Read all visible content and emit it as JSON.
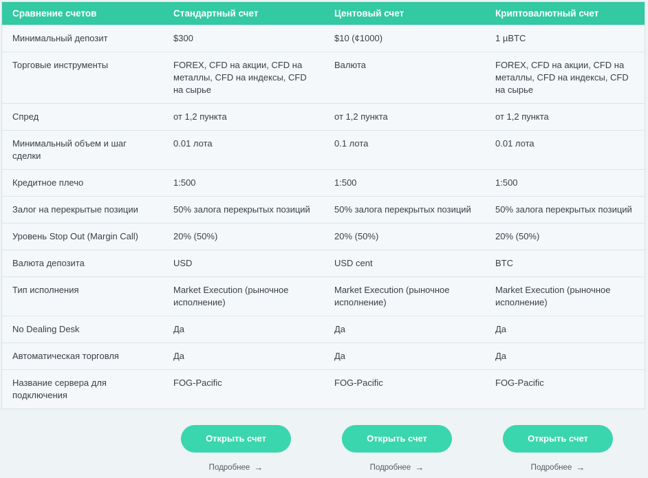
{
  "table": {
    "headers": [
      "Сравнение счетов",
      "Стандартный счет",
      "Центовый счет",
      "Криптовалютный счет"
    ],
    "rows": [
      {
        "label": "Минимальный депозит",
        "values": [
          "$300",
          "$10 (¢1000)",
          "1 µBTC"
        ]
      },
      {
        "label": "Торговые инструменты",
        "values": [
          "FOREX, CFD на акции, CFD на металлы, CFD на индексы, CFD на сырье",
          "Валюта",
          "FOREX, CFD на акции, CFD на металлы, CFD на индексы, CFD на сырье"
        ]
      },
      {
        "label": "Спред",
        "values": [
          "от 1,2 пункта",
          "от 1,2 пункта",
          "от 1,2 пункта"
        ]
      },
      {
        "label": "Минимальный объем и шаг сделки",
        "values": [
          "0.01 лота",
          "0.1 лота",
          "0.01 лота"
        ]
      },
      {
        "label": "Кредитное плечо",
        "values": [
          "1:500",
          "1:500",
          "1:500"
        ]
      },
      {
        "label": "Залог на перекрытые позиции",
        "values": [
          "50% залога перекрытых позиций",
          "50% залога перекрытых позиций",
          "50% залога перекрытых позиций"
        ]
      },
      {
        "label": "Уровень Stop Out (Margin Call)",
        "values": [
          "20% (50%)",
          "20% (50%)",
          "20% (50%)"
        ]
      },
      {
        "label": "Валюта депозита",
        "values": [
          "USD",
          "USD cent",
          "BTC"
        ]
      },
      {
        "label": "Тип исполнения",
        "values": [
          "Market Execution (рыночное исполнение)",
          "Market Execution (рыночное исполнение)",
          "Market Execution (рыночное исполнение)"
        ]
      },
      {
        "label": "No Dealing Desk",
        "values": [
          "Да",
          "Да",
          "Да"
        ]
      },
      {
        "label": "Автоматическая торговля",
        "values": [
          "Да",
          "Да",
          "Да"
        ]
      },
      {
        "label": "Название сервера для подключения",
        "values": [
          "FOG-Pacific",
          "FOG-Pacific",
          "FOG-Pacific"
        ]
      }
    ]
  },
  "cta": {
    "open_label": "Открыть счет",
    "more_label": "Подробнее",
    "arrow_icon": "arrow-right-icon"
  },
  "colors": {
    "accent": "#33c9a2",
    "button": "#3ad6ad"
  }
}
